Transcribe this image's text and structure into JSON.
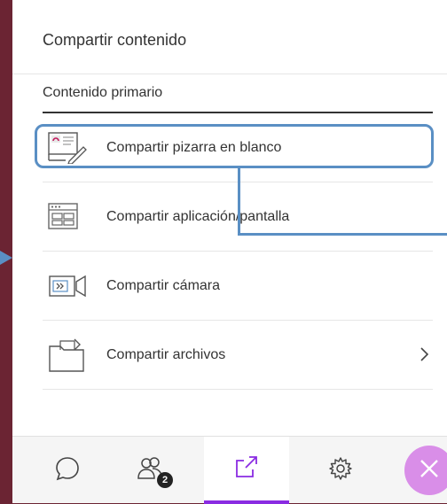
{
  "panel": {
    "title": "Compartir contenido",
    "section_title": "Contenido primario"
  },
  "menu": {
    "items": [
      {
        "label": "Compartir pizarra en blanco",
        "icon": "whiteboard-icon"
      },
      {
        "label": "Compartir aplicación/pantalla",
        "icon": "application-window-icon"
      },
      {
        "label": "Compartir cámara",
        "icon": "camera-icon"
      },
      {
        "label": "Compartir archivos",
        "icon": "folder-icon"
      }
    ]
  },
  "bottom_bar": {
    "tabs": [
      {
        "icon": "chat-icon"
      },
      {
        "icon": "participants-icon",
        "badge": "2"
      },
      {
        "icon": "share-content-icon",
        "active": true
      },
      {
        "icon": "gear-icon"
      },
      {
        "icon": "close-icon"
      }
    ]
  },
  "colors": {
    "background": "#6b2433",
    "annotation": "#5a8fc4",
    "active_tab": "#8a2be2",
    "close_button": "#d98ee8"
  }
}
